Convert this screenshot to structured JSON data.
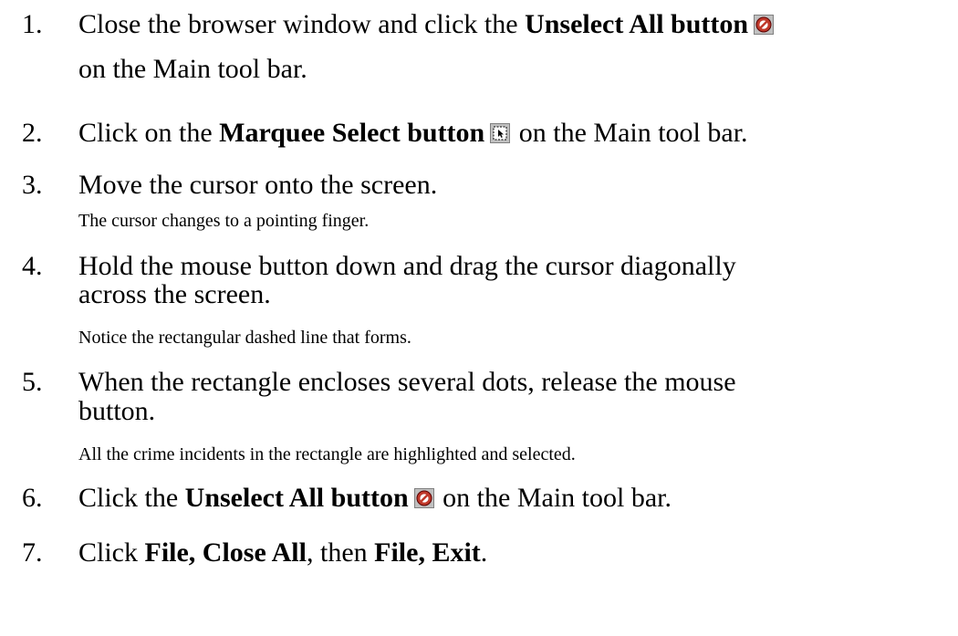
{
  "steps": [
    {
      "number": "1.",
      "line1": {
        "pre": "Close the browser window and click the ",
        "bold": "Unselect All button",
        "post": ""
      },
      "line2": "on the Main tool bar.",
      "icon": "unselect-all-icon"
    },
    {
      "number": "2.",
      "line1": {
        "pre": "Click on the ",
        "bold": "Marquee Select button",
        "post": " on the Main tool bar."
      },
      "icon": "marquee-select-icon"
    },
    {
      "number": "3.",
      "line1": " Move the cursor onto the screen.",
      "note": "The cursor changes to a pointing finger."
    },
    {
      "number": "4.",
      "line1": "Hold the mouse button down and drag the cursor diagonally",
      "line2": "across the screen.",
      "note": "Notice the rectangular dashed line that forms."
    },
    {
      "number": "5.",
      "line1": "When the rectangle encloses several dots, release the mouse",
      "line2": "button.",
      "note": "All the crime incidents in the rectangle are highlighted and selected."
    },
    {
      "number": "6.",
      "line1": {
        "pre": "Click the ",
        "bold": "Unselect All button",
        "post": " on the Main tool bar."
      },
      "icon": "unselect-all-icon"
    },
    {
      "number": "7.",
      "line1": {
        "pre": "Click ",
        "bold1": "File, Close All",
        "mid": ", then ",
        "bold2": "File, Exit",
        "post": "."
      }
    }
  ],
  "colors": {
    "unselect_icon_red": "#c0392b",
    "icon_face": "#c0c0c0"
  }
}
